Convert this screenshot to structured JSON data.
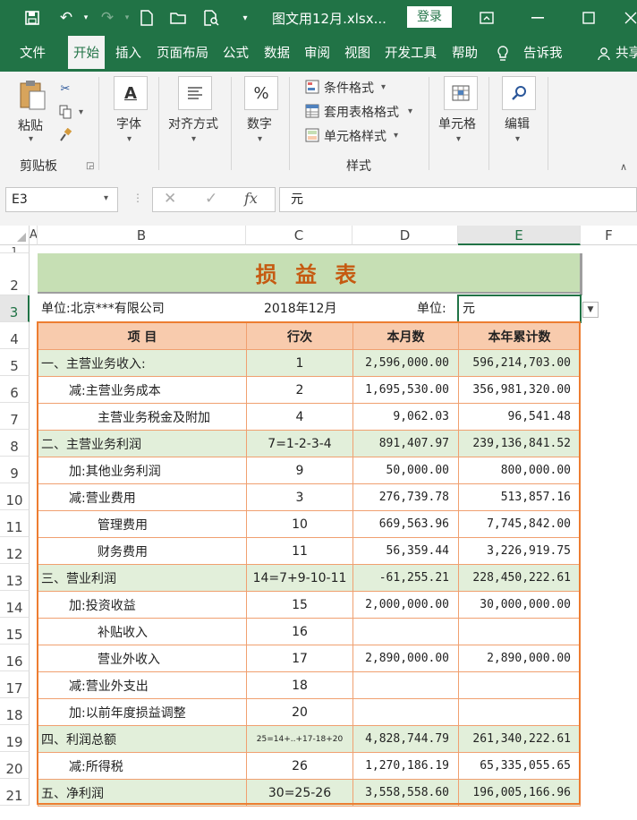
{
  "titlebar": {
    "title": "图文用12月.xlsx...",
    "login_label": "登录"
  },
  "menu": {
    "items": [
      "文件",
      "开始",
      "插入",
      "页面布局",
      "公式",
      "数据",
      "审阅",
      "视图",
      "开发工具",
      "帮助",
      "告诉我",
      "共享"
    ],
    "active": "开始"
  },
  "ribbon": {
    "paste": "粘贴",
    "clipboard": "剪贴板",
    "font": "字体",
    "align": "对齐方式",
    "number": "数字",
    "number_icon": "%",
    "cond_format": "条件格式",
    "table_format": "套用表格格式",
    "cell_style": "单元格样式",
    "styles_group": "样式",
    "cells": "单元格",
    "edit": "编辑"
  },
  "formula_bar": {
    "name_box": "E3",
    "fx": "fx",
    "value": "元"
  },
  "columns": [
    "A",
    "B",
    "C",
    "D",
    "E",
    "F"
  ],
  "rows": [
    "1",
    "2",
    "3",
    "4",
    "5",
    "6",
    "7",
    "8",
    "9",
    "10",
    "11",
    "12",
    "13",
    "14",
    "15",
    "16",
    "17",
    "18",
    "19",
    "20",
    "21"
  ],
  "sheet": {
    "title": "损  益  表",
    "unit_company": "单位:北京***有限公司",
    "period": "2018年12月",
    "unit_label": "单位:",
    "unit_value": "元",
    "headers": [
      "项      目",
      "行次",
      "本月数",
      "本年累计数"
    ],
    "rows": [
      {
        "item": "一、主营业务收入:",
        "line": "1",
        "month": "2,596,000.00",
        "ytd": "596,214,703.00",
        "green": true,
        "indent": 0
      },
      {
        "item": "减:主营业务成本",
        "line": "2",
        "month": "1,695,530.00",
        "ytd": "356,981,320.00",
        "green": false,
        "indent": 1
      },
      {
        "item": "主营业务税金及附加",
        "line": "4",
        "month": "9,062.03",
        "ytd": "96,541.48",
        "green": false,
        "indent": 2
      },
      {
        "item": "二、主营业务利润",
        "line": "7=1-2-3-4",
        "month": "891,407.97",
        "ytd": "239,136,841.52",
        "green": true,
        "indent": 0
      },
      {
        "item": "加:其他业务利润",
        "line": "9",
        "month": "50,000.00",
        "ytd": "800,000.00",
        "green": false,
        "indent": 1
      },
      {
        "item": "减:营业费用",
        "line": "3",
        "month": "276,739.78",
        "ytd": "513,857.16",
        "green": false,
        "indent": 1
      },
      {
        "item": "管理费用",
        "line": "10",
        "month": "669,563.96",
        "ytd": "7,745,842.00",
        "green": false,
        "indent": 2
      },
      {
        "item": "财务费用",
        "line": "11",
        "month": "56,359.44",
        "ytd": "3,226,919.75",
        "green": false,
        "indent": 2
      },
      {
        "item": "三、营业利润",
        "line": "14=7+9-10-11",
        "month": "-61,255.21",
        "ytd": "228,450,222.61",
        "green": true,
        "indent": 0
      },
      {
        "item": "加:投资收益",
        "line": "15",
        "month": "2,000,000.00",
        "ytd": "30,000,000.00",
        "green": false,
        "indent": 1
      },
      {
        "item": "补贴收入",
        "line": "16",
        "month": "",
        "ytd": "",
        "green": false,
        "indent": 2
      },
      {
        "item": "营业外收入",
        "line": "17",
        "month": "2,890,000.00",
        "ytd": "2,890,000.00",
        "green": false,
        "indent": 2
      },
      {
        "item": "减:营业外支出",
        "line": "18",
        "month": "",
        "ytd": "",
        "green": false,
        "indent": 1
      },
      {
        "item": "加:以前年度损益调整",
        "line": "20",
        "month": "",
        "ytd": "",
        "green": false,
        "indent": 1
      },
      {
        "item": "四、利润总额",
        "line": "25=14+..+17-18+20",
        "month": "4,828,744.79",
        "ytd": "261,340,222.61",
        "green": true,
        "indent": 0,
        "small": true
      },
      {
        "item": "减:所得税",
        "line": "26",
        "month": "1,270,186.19",
        "ytd": "65,335,055.65",
        "green": false,
        "indent": 1
      },
      {
        "item": "五、净利润",
        "line": "30=25-26",
        "month": "3,558,558.60",
        "ytd": "196,005,166.96",
        "green": true,
        "indent": 0
      }
    ]
  }
}
